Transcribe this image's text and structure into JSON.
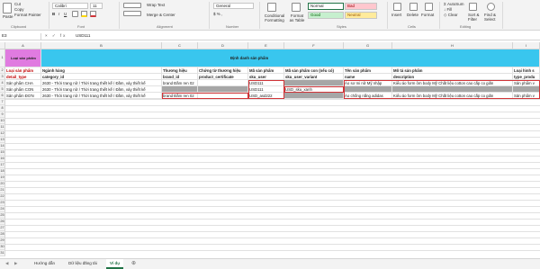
{
  "ribbon": {
    "paste": "Paste",
    "cut": "Cut",
    "copy": "Copy",
    "format_painter": "Format Painter",
    "clipboard": "Clipboard",
    "font_name": "Calibri",
    "font_size": "11",
    "bold": "B",
    "italic": "I",
    "underline": "U",
    "font": "Font",
    "wrap_text": "Wrap Text",
    "merge_center": "Merge & Center",
    "alignment": "Alignment",
    "number_format": "General",
    "number": "Number",
    "conditional_formatting": "Conditional Formatting",
    "format_as_table": "Format as Table",
    "style_normal": "Normal",
    "style_bad": "Bad",
    "style_good": "Good",
    "style_neutral": "Neutral",
    "styles": "Styles",
    "insert": "Insert",
    "delete": "Delete",
    "format": "Format",
    "cells": "Cells",
    "autosum": "AutoSum",
    "fill": "Fill",
    "clear": "Clear",
    "sort_filter": "Sort & Filter",
    "find_select": "Find & Select",
    "editing": "Editing"
  },
  "formula_bar": {
    "name_box": "E3",
    "fx": "× ✓ fx",
    "formula": "USD111"
  },
  "columns": [
    "A",
    "B",
    "C",
    "D",
    "E",
    "F",
    "G",
    "H",
    "I"
  ],
  "rows": [
    "1",
    "2",
    "3",
    "4",
    "5",
    "6",
    "7",
    "8",
    "9",
    "10",
    "11",
    "12",
    "13",
    "14",
    "15",
    "16",
    "17",
    "18",
    "19",
    "20",
    "21",
    "22",
    "23",
    "24",
    "25",
    "26",
    "27",
    "28",
    "29",
    "30",
    "31",
    "32"
  ],
  "cells": {
    "a1": "Loại sản phẩm",
    "basic_header": "Định danh sản phẩm",
    "a2": "Loại sản phẩm",
    "b2": "Ngành hàng",
    "c2": "Thương hiệu",
    "d2": "Chứng từ thương hiệu",
    "e2": "Mã sản phẩm",
    "f2": "Mã sản phẩm con (nếu có)",
    "g2": "Tên sản phẩm",
    "h2": "Mô tả sản phẩm",
    "i2": "Loại hình s",
    "a3": "detail_type",
    "b3": "category_id",
    "c3": "brand_id",
    "d3": "product_certificate",
    "e3": "sku_user",
    "f3": "sku_user_variant",
    "g3": "name",
    "h3": "description",
    "i3": "type_produ",
    "a4": "Sản phẩm CHA",
    "b4": "2630 - Thời trang nữ / Thời trang thiết kế / Đầm, váy thiết kế",
    "c4": "brand Đầm ren 02",
    "d4": "",
    "e4": "USD111",
    "f4": "",
    "g4": "Áo sơ mi nữ Mỹ nhập",
    "h4": "Kiểu áo form ôm body Mỹ Chất liệu cotton cao cấp co giãn",
    "i4": "Sản phẩm v",
    "a5": "Sản phẩm CON",
    "b5": "2630 - Thời trang nữ / Thời trang thiết kế / Đầm, váy thiết kế",
    "c5": "",
    "d5": "",
    "e5": "USD111",
    "f5": "USD_sku_xanh",
    "g5": "",
    "h5": "",
    "i5": "",
    "a6": "Sản phẩm ĐƠN",
    "b6": "2630 - Thời trang nữ / Thời trang thiết kế / Đầm, váy thiết kế",
    "c6": "brand Đầm ren 02",
    "d6": "",
    "e6": "USD_asd222",
    "f6": "",
    "g6": "Áo chống nắng adidas",
    "h6": "Kiểu áo form ôm body Mỹ Chất liệu cotton cao cấp co giãn",
    "i6": "Sản phẩm v"
  },
  "sheet_tabs": [
    "Hướng dẫn",
    "Dữ liệu đăng tải",
    "Ví dụ"
  ],
  "colors": {
    "header_magenta": "#e07be0",
    "header_cyan": "#39c6ee",
    "header_text_red": "#c00000",
    "gray_cell": "#a6a6a6",
    "selection_red": "#d13438",
    "excel_green": "#217346"
  }
}
